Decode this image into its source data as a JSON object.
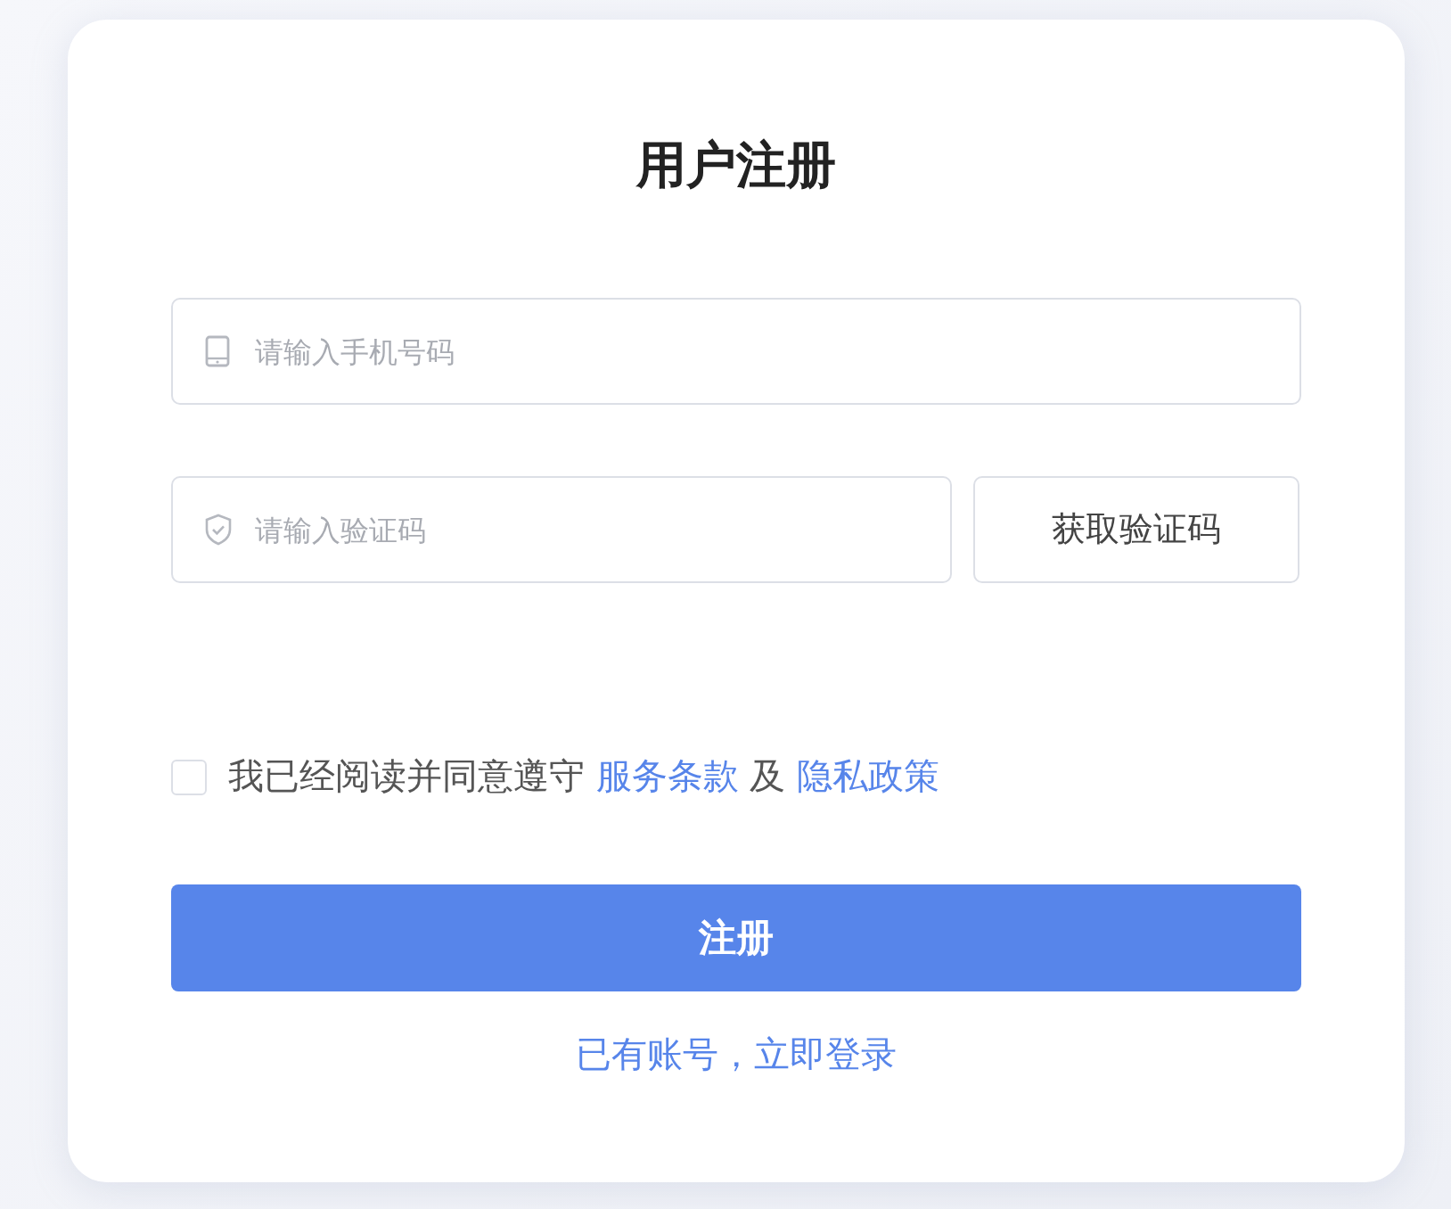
{
  "title": "用户注册",
  "phone_field": {
    "placeholder": "请输入手机号码"
  },
  "code_field": {
    "placeholder": "请输入验证码"
  },
  "get_code_button": "获取验证码",
  "agreement": {
    "checked": false,
    "text": "我已经阅读并同意遵守",
    "terms_link": "服务条款",
    "conjunction": "及",
    "privacy_link": "隐私政策"
  },
  "register_button": "注册",
  "login_link": "已有账号，立即登录"
}
